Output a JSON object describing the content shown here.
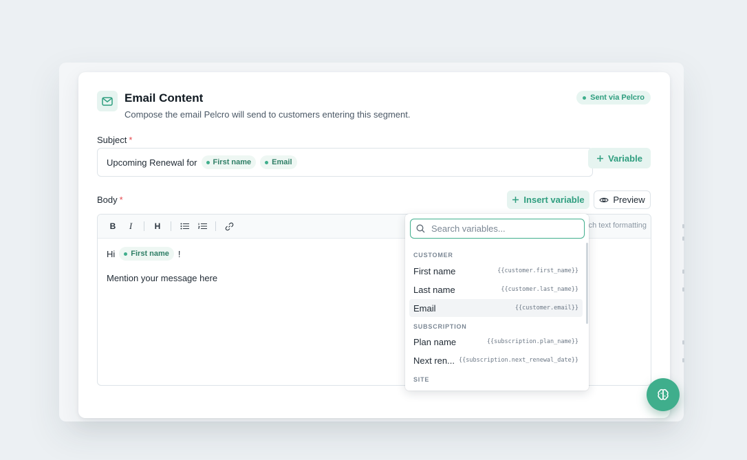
{
  "header": {
    "title": "Email Content",
    "subtitle": "Compose the email Pelcro will send to customers entering this segment.",
    "badge": "Sent via Pelcro"
  },
  "subject": {
    "label": "Subject",
    "required_mark": "*",
    "text": "Upcoming Renewal for",
    "chips": [
      "First name",
      "Email"
    ],
    "variable_button": "Variable"
  },
  "body": {
    "label": "Body",
    "required_mark": "*",
    "insert_button": "Insert variable",
    "preview_button": "Preview",
    "toolbar": {
      "bold": "B",
      "italic": "I",
      "heading": "H",
      "hint": "ch text formatting"
    },
    "greeting": "Hi",
    "greeting_chip": "First name",
    "greeting_end": "!",
    "message": "Mention your message here"
  },
  "dropdown": {
    "search_placeholder": "Search variables...",
    "sections": [
      {
        "label": "CUSTOMER",
        "items": [
          {
            "name": "First name",
            "code": "{{customer.first_name}}"
          },
          {
            "name": "Last name",
            "code": "{{customer.last_name}}"
          },
          {
            "name": "Email",
            "code": "{{customer.email}}"
          }
        ]
      },
      {
        "label": "SUBSCRIPTION",
        "items": [
          {
            "name": "Plan name",
            "code": "{{subscription.plan_name}}"
          },
          {
            "name": "Next ren...",
            "code": "{{subscription.next_renewal_date}}"
          }
        ]
      },
      {
        "label": "SITE",
        "items": []
      }
    ]
  },
  "colors": {
    "accent": "#3fae8c",
    "accent_text": "#2f9e7f",
    "accent_bg": "#e6f4f0",
    "required": "#e5484d"
  },
  "icons": {
    "header": "mail-icon",
    "badge": "status-dot-icon",
    "variable": "plus-icon",
    "preview": "eye-icon",
    "search": "search-icon",
    "fab": "brain-icon"
  }
}
